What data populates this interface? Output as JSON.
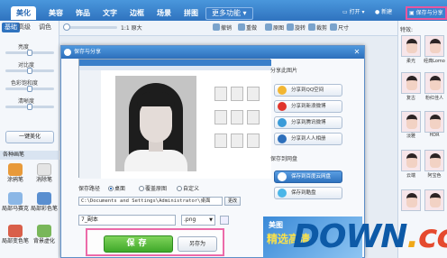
{
  "topbar": {
    "tabs": [
      "美化",
      "美容",
      "饰品",
      "文字",
      "边框",
      "场景",
      "拼图"
    ],
    "more_tab": "更多功能 ▾",
    "open_label": "打开",
    "new_label": "新建",
    "save_share_label": "保存与分享"
  },
  "toolbar": {
    "zoom_label": "1:1 原大",
    "items": [
      "撤销",
      "重做",
      "原图",
      "旋转",
      "裁剪",
      "尺寸"
    ]
  },
  "left_panel": {
    "tabs": [
      "基础",
      "高级",
      "调色"
    ],
    "sliders": [
      {
        "label": "亮度",
        "value": 0.5
      },
      {
        "label": "对比度",
        "value": 0.5
      },
      {
        "label": "色彩饱和度",
        "value": 0.5
      },
      {
        "label": "清晰度",
        "value": 0.5
      }
    ],
    "oneclick_label": "一键美化",
    "pen_title": "各种画笔",
    "pens": [
      "涂鸦笔",
      "消除笔",
      "局部马赛克",
      "局部彩色笔",
      "局部变色笔",
      "背景虚化"
    ]
  },
  "right_panel": {
    "title": "特效:",
    "thumbs": [
      "柔光",
      "经典Lomo",
      "复古",
      "粉红佳人",
      "淡雅",
      "HDR",
      "云端",
      "阿宝色",
      "",
      ""
    ]
  },
  "dialog": {
    "title": "保存与分享",
    "path_label": "保存路径",
    "radio_desktop": "桌面",
    "radio_overwrite": "覆盖原图",
    "radio_custom": "自定义",
    "path_value": "C:\\Documents and Settings\\Administrator\\桌面",
    "change_label": "更改",
    "filename": "7_副本",
    "extension": ".png",
    "save_label": "保存",
    "save_as_label": "另存为",
    "share_header": "分享此图片",
    "share_buttons": [
      "分享到QQ空间",
      "分享到新浪微博",
      "分享到腾讯微博",
      "分享到人人相册"
    ],
    "cloud_header": "保存到网盘",
    "cloud_buttons": [
      "保存到百度云网盘",
      "保存到酷盘"
    ],
    "ad_line1": "美图",
    "ad_line2": "精选高清"
  },
  "watermark": {
    "main": "DOWN",
    "dot": ".",
    "tld": "cc"
  },
  "colors": {
    "accent": "#2f73bf",
    "save_green": "#3fa82a",
    "highlight_pink": "#ec6aa9"
  }
}
